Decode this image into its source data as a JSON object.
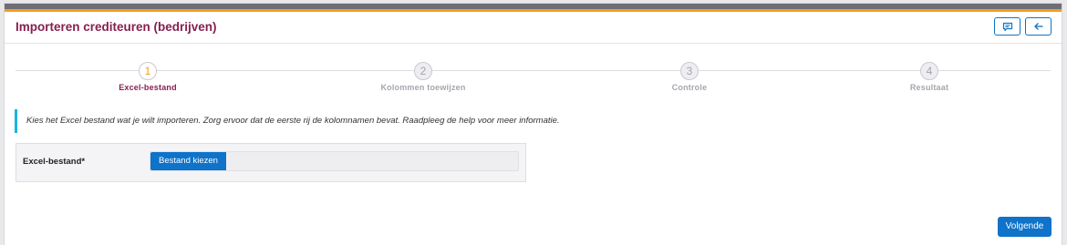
{
  "header": {
    "title": "Importeren crediteuren (bedrijven)",
    "buttons": [
      {
        "icon": "comment-icon"
      },
      {
        "icon": "arrow-left-icon"
      }
    ]
  },
  "steps": [
    {
      "number": "1",
      "label": "Excel-bestand",
      "active": true
    },
    {
      "number": "2",
      "label": "Kolommen toewijzen",
      "active": false
    },
    {
      "number": "3",
      "label": "Controle",
      "active": false
    },
    {
      "number": "4",
      "label": "Resultaat",
      "active": false
    }
  ],
  "info": {
    "text": "Kies het Excel bestand wat je wilt importeren. Zorg ervoor dat de eerste rij de kolomnamen bevat. Raadpleeg de help voor meer informatie."
  },
  "form": {
    "label": "Excel-bestand*",
    "file_button": "Bestand kiezen",
    "file_value": ""
  },
  "footer": {
    "next_label": "Volgende"
  },
  "colors": {
    "brand": "#86204f",
    "accent": "#f2a01b",
    "primary": "#0e73c9",
    "info": "#19b4e8"
  }
}
